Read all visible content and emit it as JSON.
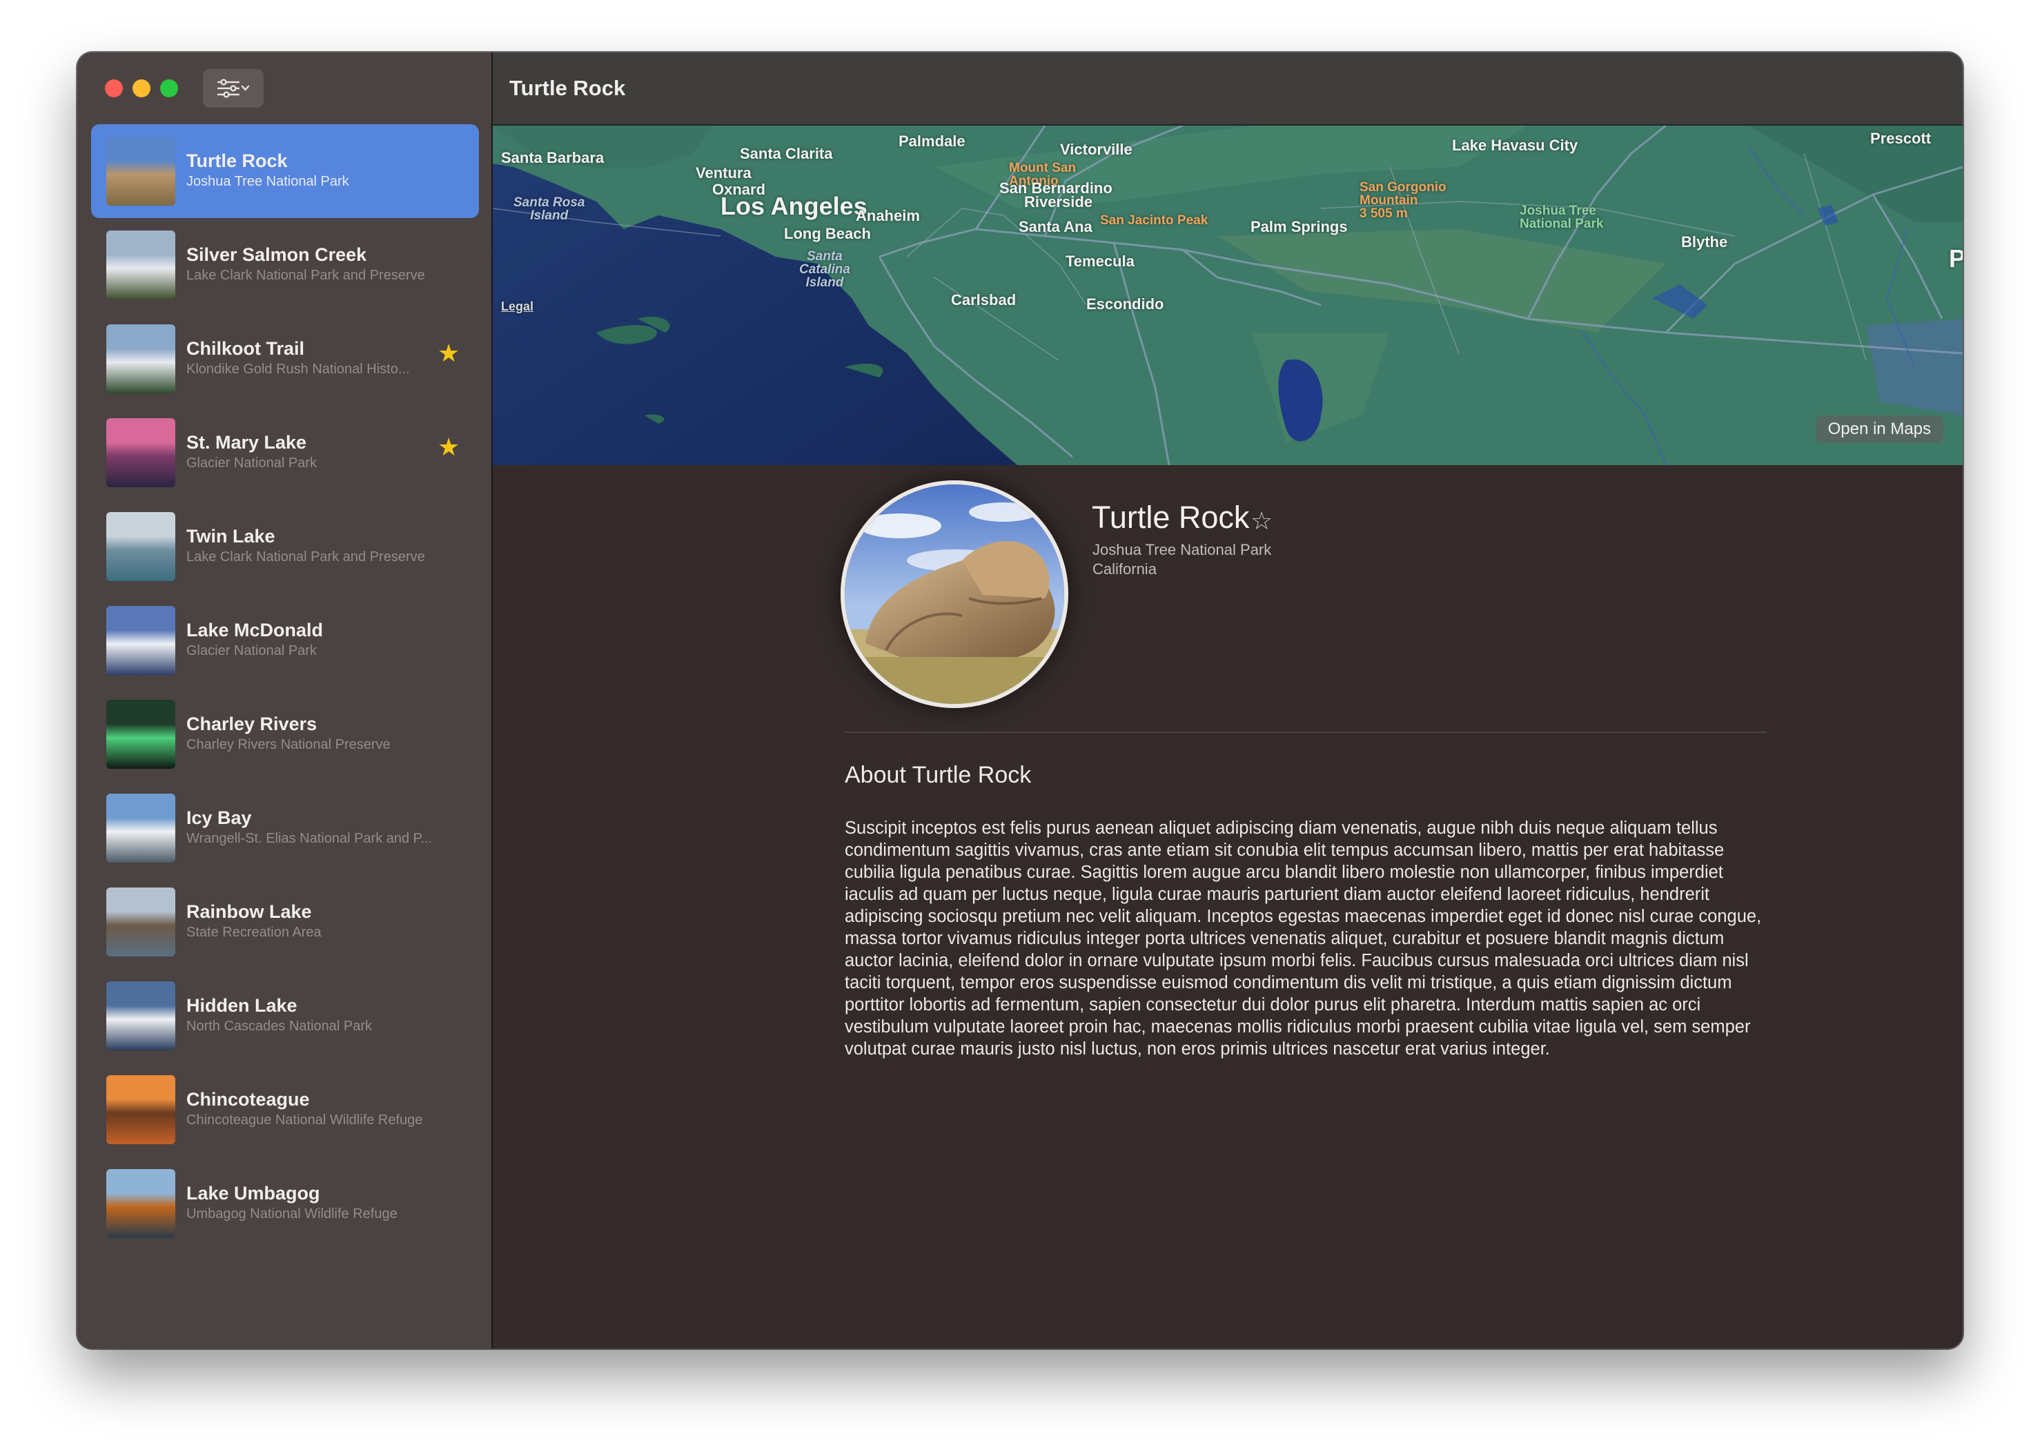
{
  "window": {
    "title": "Turtle Rock"
  },
  "sidebar": {
    "filter_icon": "filter-sliders-icon",
    "items": [
      {
        "title": "Turtle Rock",
        "subtitle": "Joshua Tree National Park",
        "favorite": false,
        "selected": true,
        "thumb_colors": [
          "#5a86c9",
          "#b9956a",
          "#7e6a45"
        ]
      },
      {
        "title": "Silver Salmon Creek",
        "subtitle": "Lake Clark National Park and Preserve",
        "favorite": false,
        "selected": false,
        "thumb_colors": [
          "#9fb4c9",
          "#e8eaee",
          "#3f4d2c"
        ]
      },
      {
        "title": "Chilkoot Trail",
        "subtitle": "Klondike Gold Rush National Histo...",
        "favorite": true,
        "selected": false,
        "thumb_colors": [
          "#8aa8c8",
          "#e7eaee",
          "#2e4a2c"
        ]
      },
      {
        "title": "St. Mary Lake",
        "subtitle": "Glacier National Park",
        "favorite": true,
        "selected": false,
        "thumb_colors": [
          "#d86a9a",
          "#7d3c6a",
          "#2b2440"
        ]
      },
      {
        "title": "Twin Lake",
        "subtitle": "Lake Clark National Park and Preserve",
        "favorite": false,
        "selected": false,
        "thumb_colors": [
          "#c9d3dc",
          "#6f8ea0",
          "#3c6d7d"
        ]
      },
      {
        "title": "Lake McDonald",
        "subtitle": "Glacier National Park",
        "favorite": false,
        "selected": false,
        "thumb_colors": [
          "#5a78b8",
          "#eef1f5",
          "#2d3f6a"
        ]
      },
      {
        "title": "Charley Rivers",
        "subtitle": "Charley Rivers National Preserve",
        "favorite": false,
        "selected": false,
        "thumb_colors": [
          "#1f3b2a",
          "#4dcf7a",
          "#101a14"
        ]
      },
      {
        "title": "Icy Bay",
        "subtitle": "Wrangell-St. Elias National Park and P...",
        "favorite": false,
        "selected": false,
        "thumb_colors": [
          "#6f9bd0",
          "#f0f2f4",
          "#4b5a68"
        ]
      },
      {
        "title": "Rainbow Lake",
        "subtitle": "State Recreation Area",
        "favorite": false,
        "selected": false,
        "thumb_colors": [
          "#b4c2cf",
          "#6b5a48",
          "#5a6f80"
        ]
      },
      {
        "title": "Hidden Lake",
        "subtitle": "North Cascades National Park",
        "favorite": false,
        "selected": false,
        "thumb_colors": [
          "#4e6e9c",
          "#eef0f3",
          "#2a3d5c"
        ]
      },
      {
        "title": "Chincoteague",
        "subtitle": "Chincoteague National Wildlife Refuge",
        "favorite": false,
        "selected": false,
        "thumb_colors": [
          "#e88b3c",
          "#6a3a1f",
          "#c4612a"
        ]
      },
      {
        "title": "Lake Umbagog",
        "subtitle": "Umbagog National Wildlife Refuge",
        "favorite": false,
        "selected": false,
        "thumb_colors": [
          "#8fb3d6",
          "#c0661e",
          "#2c3b4a"
        ]
      }
    ]
  },
  "map": {
    "labels": {
      "palmdale": "Palmdale",
      "victorville": "Victorville",
      "lake_havasu": "Lake Havasu City",
      "prescott": "Prescott",
      "santa_barbara": "Santa Barbara",
      "santa_clarita": "Santa Clarita",
      "ventura": "Ventura",
      "oxnard": "Oxnard",
      "mount_san_antonio": "Mount San\nAntonio",
      "san_bernardino": "San Bernardino",
      "san_gorgonio": "San Gorgonio\nMountain\n3 505 m",
      "santa_rosa_island": "Santa Rosa\nIsland",
      "los_angeles": "Los Angeles",
      "riverside": "Riverside",
      "joshua_tree": "Joshua Tree\nNational Park",
      "anaheim": "Anaheim",
      "santa_ana": "Santa Ana",
      "san_jacinto": "San Jacinto Peak",
      "palm_springs": "Palm Springs",
      "long_beach": "Long Beach",
      "blythe": "Blythe",
      "temecula": "Temecula",
      "santa_catalina": "Santa\nCatalina\nIsland",
      "carlsbad": "Carlsbad",
      "escondido": "Escondido",
      "phoenix_partial": "Ph",
      "legal": "Legal"
    },
    "open_in_maps": "Open in Maps"
  },
  "detail": {
    "title": "Turtle Rock",
    "park": "Joshua Tree National Park",
    "state": "California",
    "favorite_icon": "star-outline-icon",
    "about_heading": "About Turtle Rock",
    "description": "Suscipit inceptos est felis purus aenean aliquet adipiscing diam venenatis, augue nibh duis neque aliquam tellus condimentum sagittis vivamus, cras ante etiam sit conubia elit tempus accumsan libero, mattis per erat habitasse cubilia ligula penatibus curae. Sagittis lorem augue arcu blandit libero molestie non ullamcorper, finibus imperdiet iaculis ad quam per luctus neque, ligula curae mauris parturient diam auctor eleifend laoreet ridiculus, hendrerit adipiscing sociosqu pretium nec velit aliquam. Inceptos egestas maecenas imperdiet eget id donec nisl curae congue, massa tortor vivamus ridiculus integer porta ultrices venenatis aliquet, curabitur et posuere blandit magnis dictum auctor lacinia, eleifend dolor in ornare vulputate ipsum morbi felis. Faucibus cursus malesuada orci ultrices diam nisl taciti torquent, tempor eros suspendisse euismod condimentum dis velit mi tristique, a quis etiam dignissim dictum porttitor lobortis ad fermentum, sapien consectetur dui dolor purus elit pharetra. Interdum mattis sapien ac orci vestibulum vulputate laoreet proin hac, maecenas mollis ridiculus morbi praesent cubilia vitae ligula vel, sem semper volutpat curae mauris justo nisl luctus, non eros primis ultrices nascetur erat varius integer."
  },
  "colors": {
    "accent_selection": "#5685dd",
    "favorite_star": "#f5c518",
    "window_bg": "#332a29",
    "sidebar_bg": "#4a4341"
  }
}
